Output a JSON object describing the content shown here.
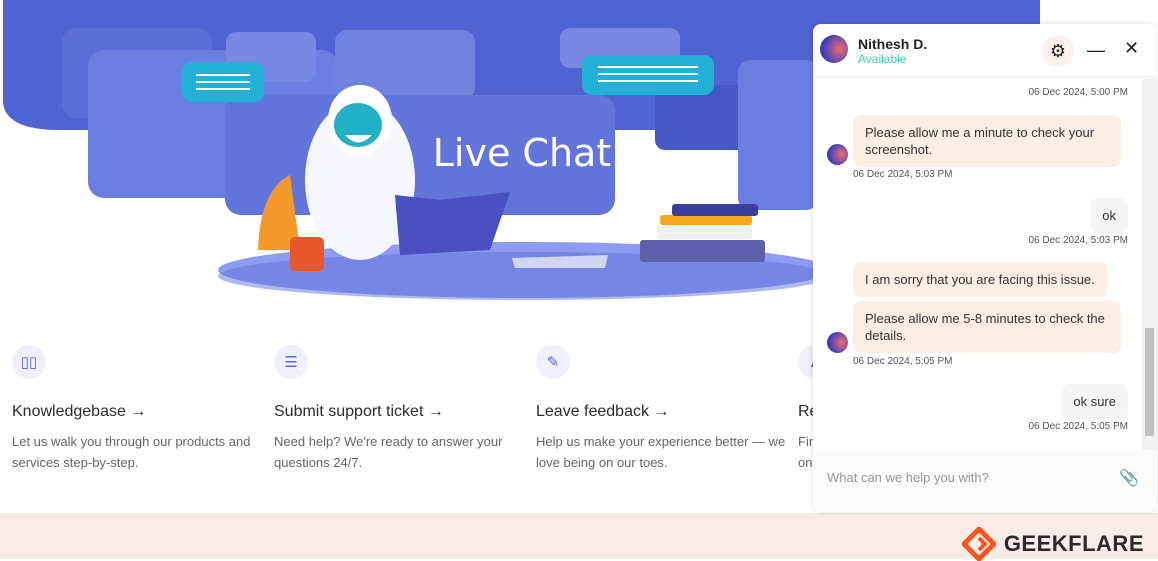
{
  "hero": {
    "title": "Live Chat"
  },
  "cards": [
    {
      "icon": "book-icon",
      "title": "Knowledgebase →",
      "desc": "Let us walk you through our products and services step-by-step."
    },
    {
      "icon": "ticket-icon",
      "title": "Submit support ticket →",
      "desc": "Need help? We're ready to answer your questions 24/7."
    },
    {
      "icon": "feedback-icon",
      "title": "Leave feedback →",
      "desc": "Help us make your experience better — we love being on our toes."
    },
    {
      "icon": "report-icon",
      "title": "Re",
      "desc": "Fin on"
    }
  ],
  "chat": {
    "agent_name": "Nithesh D.",
    "agent_status": "Available",
    "messages": [
      {
        "from": "user",
        "text": "",
        "time": "06 Dec 2024, 5:00 PM"
      },
      {
        "from": "agent",
        "text": "Please allow me a minute to check your screenshot.",
        "time": "06 Dec 2024, 5:03 PM"
      },
      {
        "from": "user",
        "text": "ok",
        "time": "06 Dec 2024, 5:03 PM"
      },
      {
        "from": "agent",
        "text": "I am sorry that you are facing this issue.",
        "time": ""
      },
      {
        "from": "agent",
        "text": "Please allow me 5-8 minutes to check the details.",
        "time": "06 Dec 2024, 5:05 PM"
      },
      {
        "from": "user",
        "text": "ok sure",
        "time": "06 Dec 2024, 5:05 PM"
      }
    ],
    "input_placeholder": "What can we help you with?"
  },
  "footer": {
    "brand": "GEEKFLARE"
  },
  "colors": {
    "hero_blue": "#4f63d2",
    "accent_orange": "#f2561d",
    "agent_bubble": "#fdeee4",
    "status_green": "#3fcfb0"
  }
}
